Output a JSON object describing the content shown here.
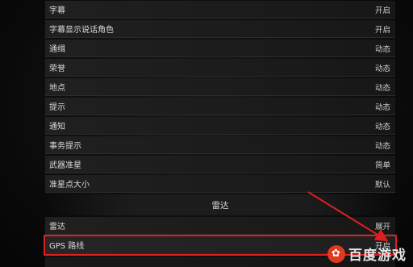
{
  "rows_top": [
    {
      "label": "字幕",
      "value": "开启"
    },
    {
      "label": "字幕显示说话角色",
      "value": "开启"
    },
    {
      "label": "通缉",
      "value": "动态"
    },
    {
      "label": "荣誉",
      "value": "动态"
    },
    {
      "label": "地点",
      "value": "动态"
    },
    {
      "label": "提示",
      "value": "动态"
    },
    {
      "label": "通知",
      "value": "动态"
    },
    {
      "label": "事务提示",
      "value": "动态"
    },
    {
      "label": "武器准星",
      "value": "简单"
    },
    {
      "label": "准星点大小",
      "value": "默认"
    }
  ],
  "section": {
    "title": "雷达"
  },
  "rows_radar": [
    {
      "label": "雷达",
      "value": "展开"
    },
    {
      "label": "GPS 路线",
      "value": "开启"
    }
  ],
  "annotation": {
    "color": "#e01e1e"
  },
  "watermark": {
    "text": "百度游戏"
  }
}
